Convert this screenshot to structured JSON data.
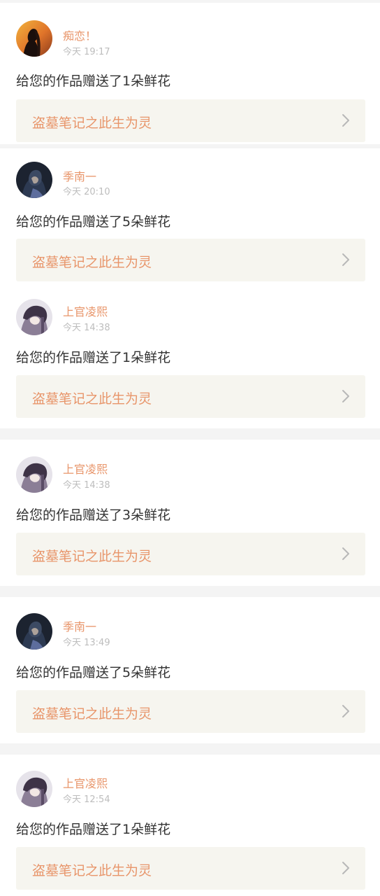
{
  "notifications": [
    {
      "username": "痴恋！",
      "time": "今天 19:17",
      "message": "给您的作品赠送了1朵鲜花",
      "work_title": "盗墓笔记之此生为灵",
      "avatar": "avatar-sunset-silhouette"
    },
    {
      "username": "季南一",
      "time": "今天 20:10",
      "message": "给您的作品赠送了5朵鲜花",
      "work_title": "盗墓笔记之此生为灵",
      "avatar": "avatar-dark-portrait"
    },
    {
      "username": "上官凌熙",
      "time": "今天 14:38",
      "message": "给您的作品赠送了1朵鲜花",
      "work_title": "盗墓笔记之此生为灵",
      "avatar": "avatar-anime-character"
    },
    {
      "username": "上官凌熙",
      "time": "今天 14:38",
      "message": "给您的作品赠送了3朵鲜花",
      "work_title": "盗墓笔记之此生为灵",
      "avatar": "avatar-anime-character"
    },
    {
      "username": "季南一",
      "time": "今天 13:49",
      "message": "给您的作品赠送了5朵鲜花",
      "work_title": "盗墓笔记之此生为灵",
      "avatar": "avatar-dark-portrait"
    },
    {
      "username": "上官凌熙",
      "time": "今天 12:54",
      "message": "给您的作品赠送了1朵鲜花",
      "work_title": "盗墓笔记之此生为灵",
      "avatar": "avatar-anime-character"
    }
  ],
  "colors": {
    "accent": "#e8956a",
    "link_background": "#f6f5ef",
    "page_background": "#f4f4f4",
    "card_background": "#ffffff",
    "timestamp": "#bdbdbd",
    "message_text": "#333333"
  },
  "icons": {
    "chevron": "chevron-right-icon"
  }
}
